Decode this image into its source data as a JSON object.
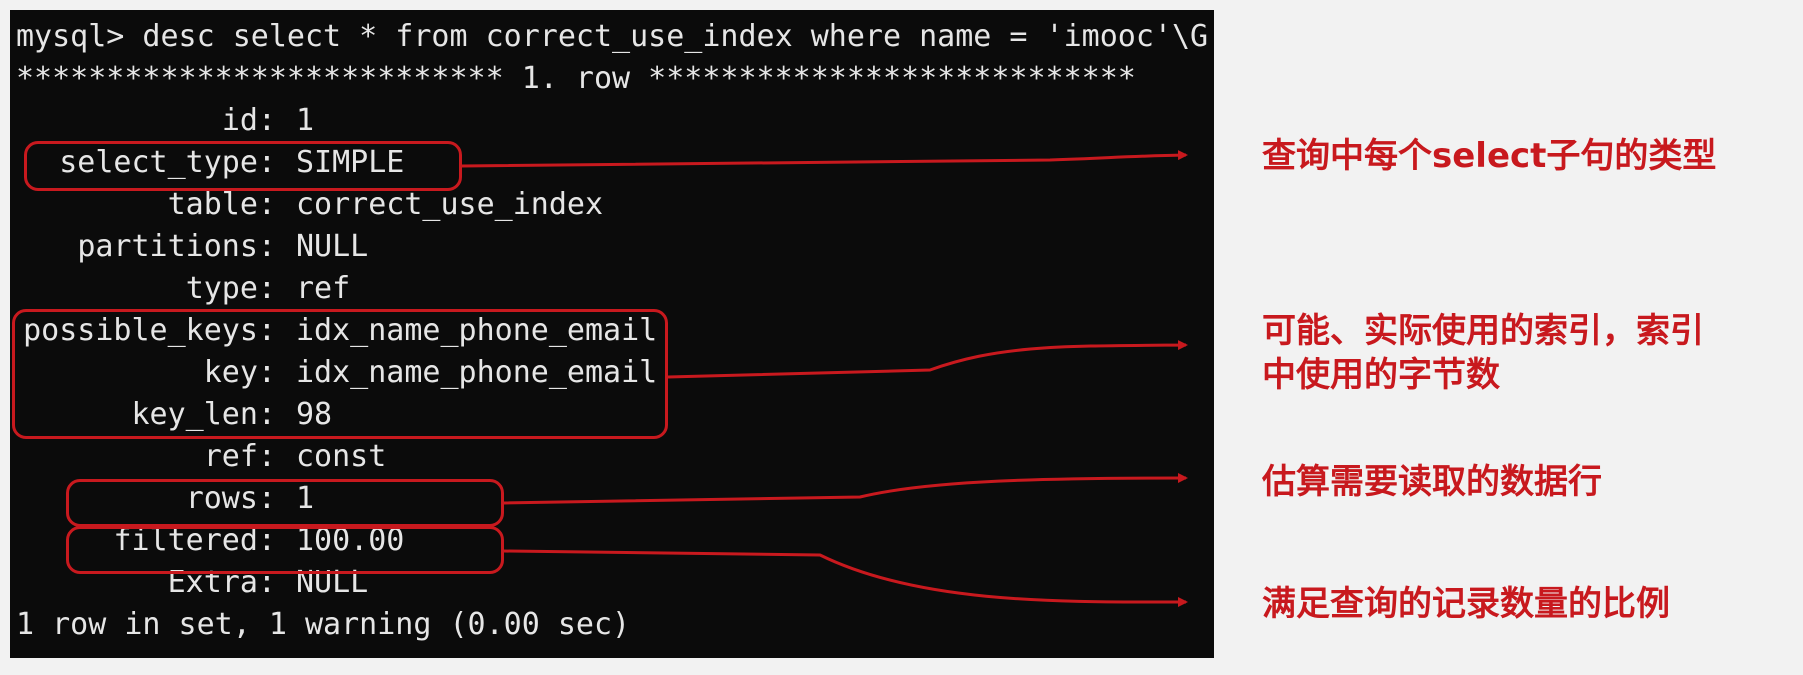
{
  "terminal": {
    "command_line": "mysql> desc select * from correct_use_index where name = 'imooc'\\G",
    "row_header": "*************************** 1. row ***************************",
    "fields": [
      {
        "key": "id:",
        "value": "1"
      },
      {
        "key": "select_type:",
        "value": "SIMPLE"
      },
      {
        "key": "table:",
        "value": "correct_use_index"
      },
      {
        "key": "partitions:",
        "value": "NULL"
      },
      {
        "key": "type:",
        "value": "ref"
      },
      {
        "key": "possible_keys:",
        "value": "idx_name_phone_email"
      },
      {
        "key": "key:",
        "value": "idx_name_phone_email"
      },
      {
        "key": "key_len:",
        "value": "98"
      },
      {
        "key": "ref:",
        "value": "const"
      },
      {
        "key": "rows:",
        "value": "1"
      },
      {
        "key": "filtered:",
        "value": "100.00"
      },
      {
        "key": "Extra:",
        "value": "NULL"
      }
    ],
    "footer": "1 row in set, 1 warning (0.00 sec)"
  },
  "annotations": {
    "select_type_note": "查询中每个select子句的类型",
    "keys_note_line1": "可能、实际使用的索引，索引",
    "keys_note_line2": "中使用的字节数",
    "rows_note": "估算需要读取的数据行",
    "filtered_note": "满足查询的记录数量的比例"
  },
  "colors": {
    "accent": "#c8191e",
    "terminal_bg": "#0b0b0b",
    "terminal_text": "#e6e6e6",
    "page_bg": "#f2f2f2"
  }
}
